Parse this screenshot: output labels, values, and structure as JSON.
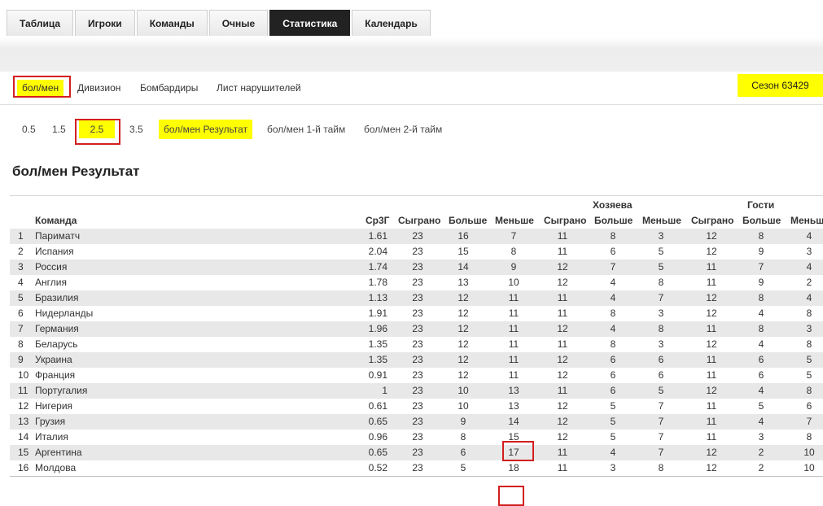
{
  "tabs": [
    "Таблица",
    "Игроки",
    "Команды",
    "Очные",
    "Статистика",
    "Календарь"
  ],
  "active_tab": "Статистика",
  "subnav": {
    "items": [
      "бол/мен",
      "Дивизион",
      "Бомбардиры",
      "Лист нарушителей"
    ],
    "season": "Сезон 63429"
  },
  "subnav2": {
    "items": [
      "0.5",
      "1.5",
      "2.5",
      "3.5",
      "бол/мен Результат",
      "бол/мен 1-й тайм",
      "бол/мен 2-й тайм"
    ]
  },
  "section_title": "бол/мен Результат",
  "table": {
    "group_headers": {
      "home": "Хозяева",
      "away": "Гости"
    },
    "columns": [
      "Команда",
      "Ср3Г",
      "Сыграно",
      "Больше",
      "Меньше",
      "Сыграно",
      "Больше",
      "Меньше",
      "Сыграно",
      "Больше",
      "Меньш"
    ],
    "rows": [
      [
        "1",
        "Париматч",
        "1.61",
        "23",
        "16",
        "7",
        "11",
        "8",
        "3",
        "12",
        "8",
        "4"
      ],
      [
        "2",
        "Испания",
        "2.04",
        "23",
        "15",
        "8",
        "11",
        "6",
        "5",
        "12",
        "9",
        "3"
      ],
      [
        "3",
        "Россия",
        "1.74",
        "23",
        "14",
        "9",
        "12",
        "7",
        "5",
        "11",
        "7",
        "4"
      ],
      [
        "4",
        "Англия",
        "1.78",
        "23",
        "13",
        "10",
        "12",
        "4",
        "8",
        "11",
        "9",
        "2"
      ],
      [
        "5",
        "Бразилия",
        "1.13",
        "23",
        "12",
        "11",
        "11",
        "4",
        "7",
        "12",
        "8",
        "4"
      ],
      [
        "6",
        "Нидерланды",
        "1.91",
        "23",
        "12",
        "11",
        "11",
        "8",
        "3",
        "12",
        "4",
        "8"
      ],
      [
        "7",
        "Германия",
        "1.96",
        "23",
        "12",
        "11",
        "12",
        "4",
        "8",
        "11",
        "8",
        "3"
      ],
      [
        "8",
        "Беларусь",
        "1.35",
        "23",
        "12",
        "11",
        "11",
        "8",
        "3",
        "12",
        "4",
        "8"
      ],
      [
        "9",
        "Украина",
        "1.35",
        "23",
        "12",
        "11",
        "12",
        "6",
        "6",
        "11",
        "6",
        "5"
      ],
      [
        "10",
        "Франция",
        "0.91",
        "23",
        "12",
        "11",
        "12",
        "6",
        "6",
        "11",
        "6",
        "5"
      ],
      [
        "11",
        "Португалия",
        "1",
        "23",
        "10",
        "13",
        "11",
        "6",
        "5",
        "12",
        "4",
        "8"
      ],
      [
        "12",
        "Нигерия",
        "0.61",
        "23",
        "10",
        "13",
        "12",
        "5",
        "7",
        "11",
        "5",
        "6"
      ],
      [
        "13",
        "Грузия",
        "0.65",
        "23",
        "9",
        "14",
        "12",
        "5",
        "7",
        "11",
        "4",
        "7"
      ],
      [
        "14",
        "Италия",
        "0.96",
        "23",
        "8",
        "15",
        "12",
        "5",
        "7",
        "11",
        "3",
        "8"
      ],
      [
        "15",
        "Аргентина",
        "0.65",
        "23",
        "6",
        "17",
        "11",
        "4",
        "7",
        "12",
        "2",
        "10"
      ],
      [
        "16",
        "Молдова",
        "0.52",
        "23",
        "5",
        "18",
        "11",
        "3",
        "8",
        "12",
        "2",
        "10"
      ]
    ]
  }
}
